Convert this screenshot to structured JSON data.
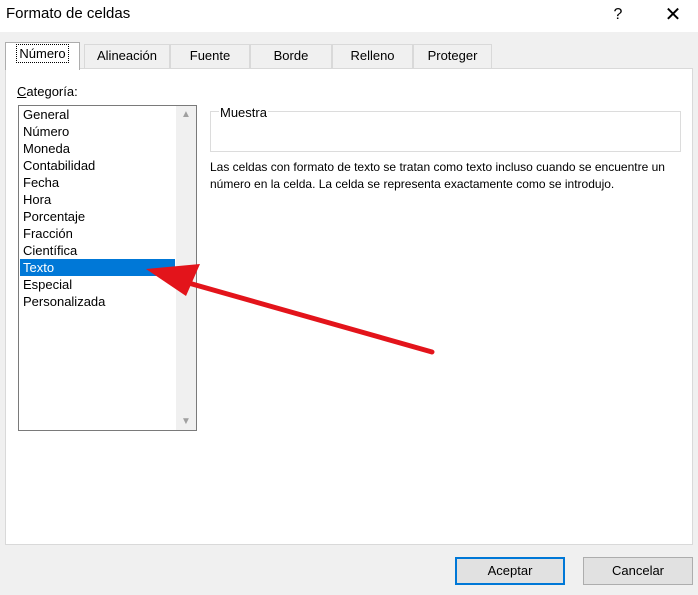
{
  "window": {
    "title": "Formato de celdas",
    "help_label": "?",
    "close_label": "✕"
  },
  "tabs": [
    {
      "label": "Número",
      "active": true
    },
    {
      "label": "Alineación",
      "active": false
    },
    {
      "label": "Fuente",
      "active": false
    },
    {
      "label": "Borde",
      "active": false
    },
    {
      "label": "Relleno",
      "active": false
    },
    {
      "label": "Proteger",
      "active": false
    }
  ],
  "category": {
    "label_first": "C",
    "label_rest": "ategoría:",
    "items": [
      "General",
      "Número",
      "Moneda",
      "Contabilidad",
      "Fecha",
      "Hora",
      "Porcentaje",
      "Fracción",
      "Científica",
      "Texto",
      "Especial",
      "Personalizada"
    ],
    "selected": "Texto"
  },
  "sample": {
    "label": "Muestra",
    "value": ""
  },
  "description": "Las celdas con formato de texto se tratan como texto incluso cuando se encuentre un número en la celda. La celda se representa exactamente como se introdujo.",
  "buttons": {
    "ok": "Aceptar",
    "cancel": "Cancelar"
  },
  "colors": {
    "selection": "#0078d7",
    "annotation_arrow": "#e3141b"
  }
}
